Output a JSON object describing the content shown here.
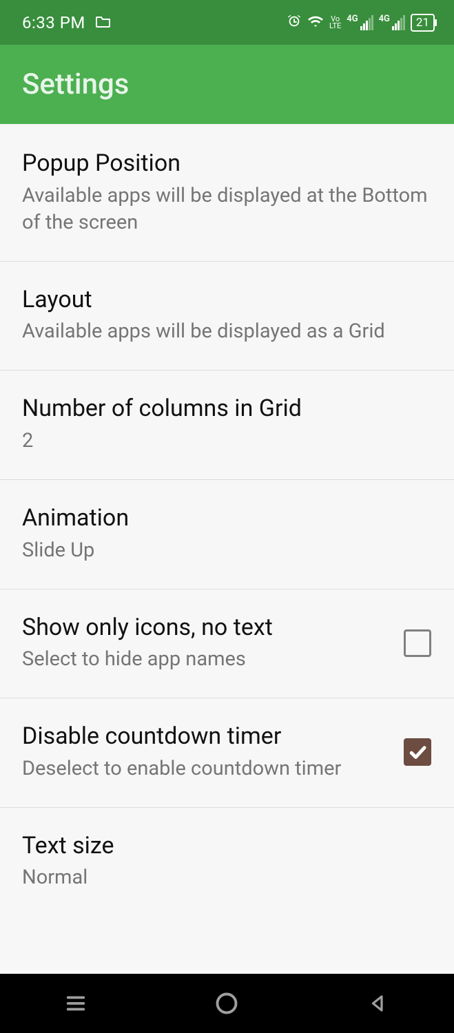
{
  "statusbar": {
    "time": "6:33 PM",
    "battery": "21",
    "net1_label": "4G",
    "net2_label": "4G",
    "volte_top": "Vo",
    "volte_bottom": "LTE"
  },
  "appbar": {
    "title": "Settings"
  },
  "rows": [
    {
      "title": "Popup Position",
      "sub": "Available apps will be displayed at the Bottom of the screen"
    },
    {
      "title": "Layout",
      "sub": "Available apps will be displayed as a Grid"
    },
    {
      "title": "Number of columns in Grid",
      "sub": "2"
    },
    {
      "title": "Animation",
      "sub": "Slide Up"
    },
    {
      "title": "Show only icons, no text",
      "sub": "Select to hide app names",
      "checkbox": true,
      "checked": false
    },
    {
      "title": "Disable countdown timer",
      "sub": "Deselect to enable countdown timer",
      "checkbox": true,
      "checked": true
    },
    {
      "title": "Text size",
      "sub": "Normal"
    }
  ]
}
